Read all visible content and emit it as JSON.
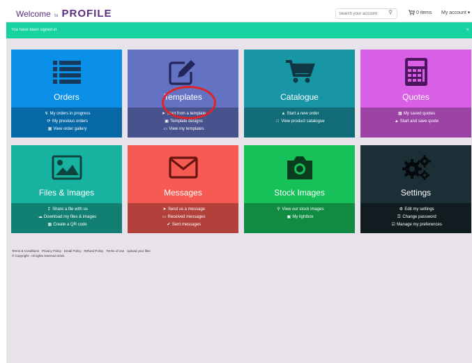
{
  "header": {
    "welcome": "Welcome",
    "to": "to",
    "logo": "PROFILE",
    "search_placeholder": "Search your account",
    "cart_label": "0 items",
    "account_label": "My account ▾"
  },
  "alert": {
    "message": "You have been signed in",
    "close": "×"
  },
  "tiles": [
    {
      "title": "Orders",
      "icon": "list-icon",
      "color": "#0a90e6",
      "links": [
        {
          "icon": "lightning-icon",
          "label": "My orders in progress"
        },
        {
          "icon": "history-icon",
          "label": "My previous orders"
        },
        {
          "icon": "gallery-icon",
          "label": "View order gallery"
        }
      ]
    },
    {
      "title": "Templates",
      "icon": "edit-icon",
      "color": "#6472c4",
      "links": [
        {
          "icon": "cursor-icon",
          "label": "Start from a template"
        },
        {
          "icon": "image-icon",
          "label": "Template designs"
        },
        {
          "icon": "folder-icon",
          "label": "View my templates"
        }
      ]
    },
    {
      "title": "Catalogue",
      "icon": "cart-icon",
      "color": "#1896a6",
      "links": [
        {
          "icon": "cart-icon",
          "label": "Start a new order"
        },
        {
          "icon": "catalogue-icon",
          "label": "View product catalogue"
        }
      ]
    },
    {
      "title": "Quotes",
      "icon": "calculator-icon",
      "color": "#d95fe6",
      "links": [
        {
          "icon": "save-icon",
          "label": "My saved quotes"
        },
        {
          "icon": "cart-icon",
          "label": "Start and save quote"
        }
      ]
    },
    {
      "title": "Files & Images",
      "icon": "picture-icon",
      "color": "#17b2a0",
      "links": [
        {
          "icon": "share-icon",
          "label": "Share a file with us"
        },
        {
          "icon": "cloud-icon",
          "label": "Download my files & images"
        },
        {
          "icon": "qr-icon",
          "label": "Create a QR code"
        }
      ]
    },
    {
      "title": "Messages",
      "icon": "envelope-icon",
      "color": "#f75a52",
      "links": [
        {
          "icon": "send-icon",
          "label": "Send us a message"
        },
        {
          "icon": "inbox-icon",
          "label": "Received messages"
        },
        {
          "icon": "check-icon",
          "label": "Sent messages"
        }
      ]
    },
    {
      "title": "Stock Images",
      "icon": "camera-icon",
      "color": "#16c15a",
      "links": [
        {
          "icon": "search-icon",
          "label": "View our stock images"
        },
        {
          "icon": "lightbox-icon",
          "label": "My lightbox"
        }
      ]
    },
    {
      "title": "Settings",
      "icon": "gears-icon",
      "color": "#1c2f36",
      "links": [
        {
          "icon": "gear-icon",
          "label": "Edit my settings"
        },
        {
          "icon": "key-icon",
          "label": "Change password"
        },
        {
          "icon": "check-square-icon",
          "label": "Manage my preferences"
        }
      ]
    }
  ],
  "footer": {
    "links": [
      "Terms & Conditions",
      "Privacy Policy",
      "Email Policy",
      "Refund Policy",
      "Terms of use",
      "Upload your files"
    ],
    "copyright": "© Copyright - All rights reserved 2016."
  },
  "annotation": {
    "shape": "circle",
    "color": "#e02424"
  }
}
